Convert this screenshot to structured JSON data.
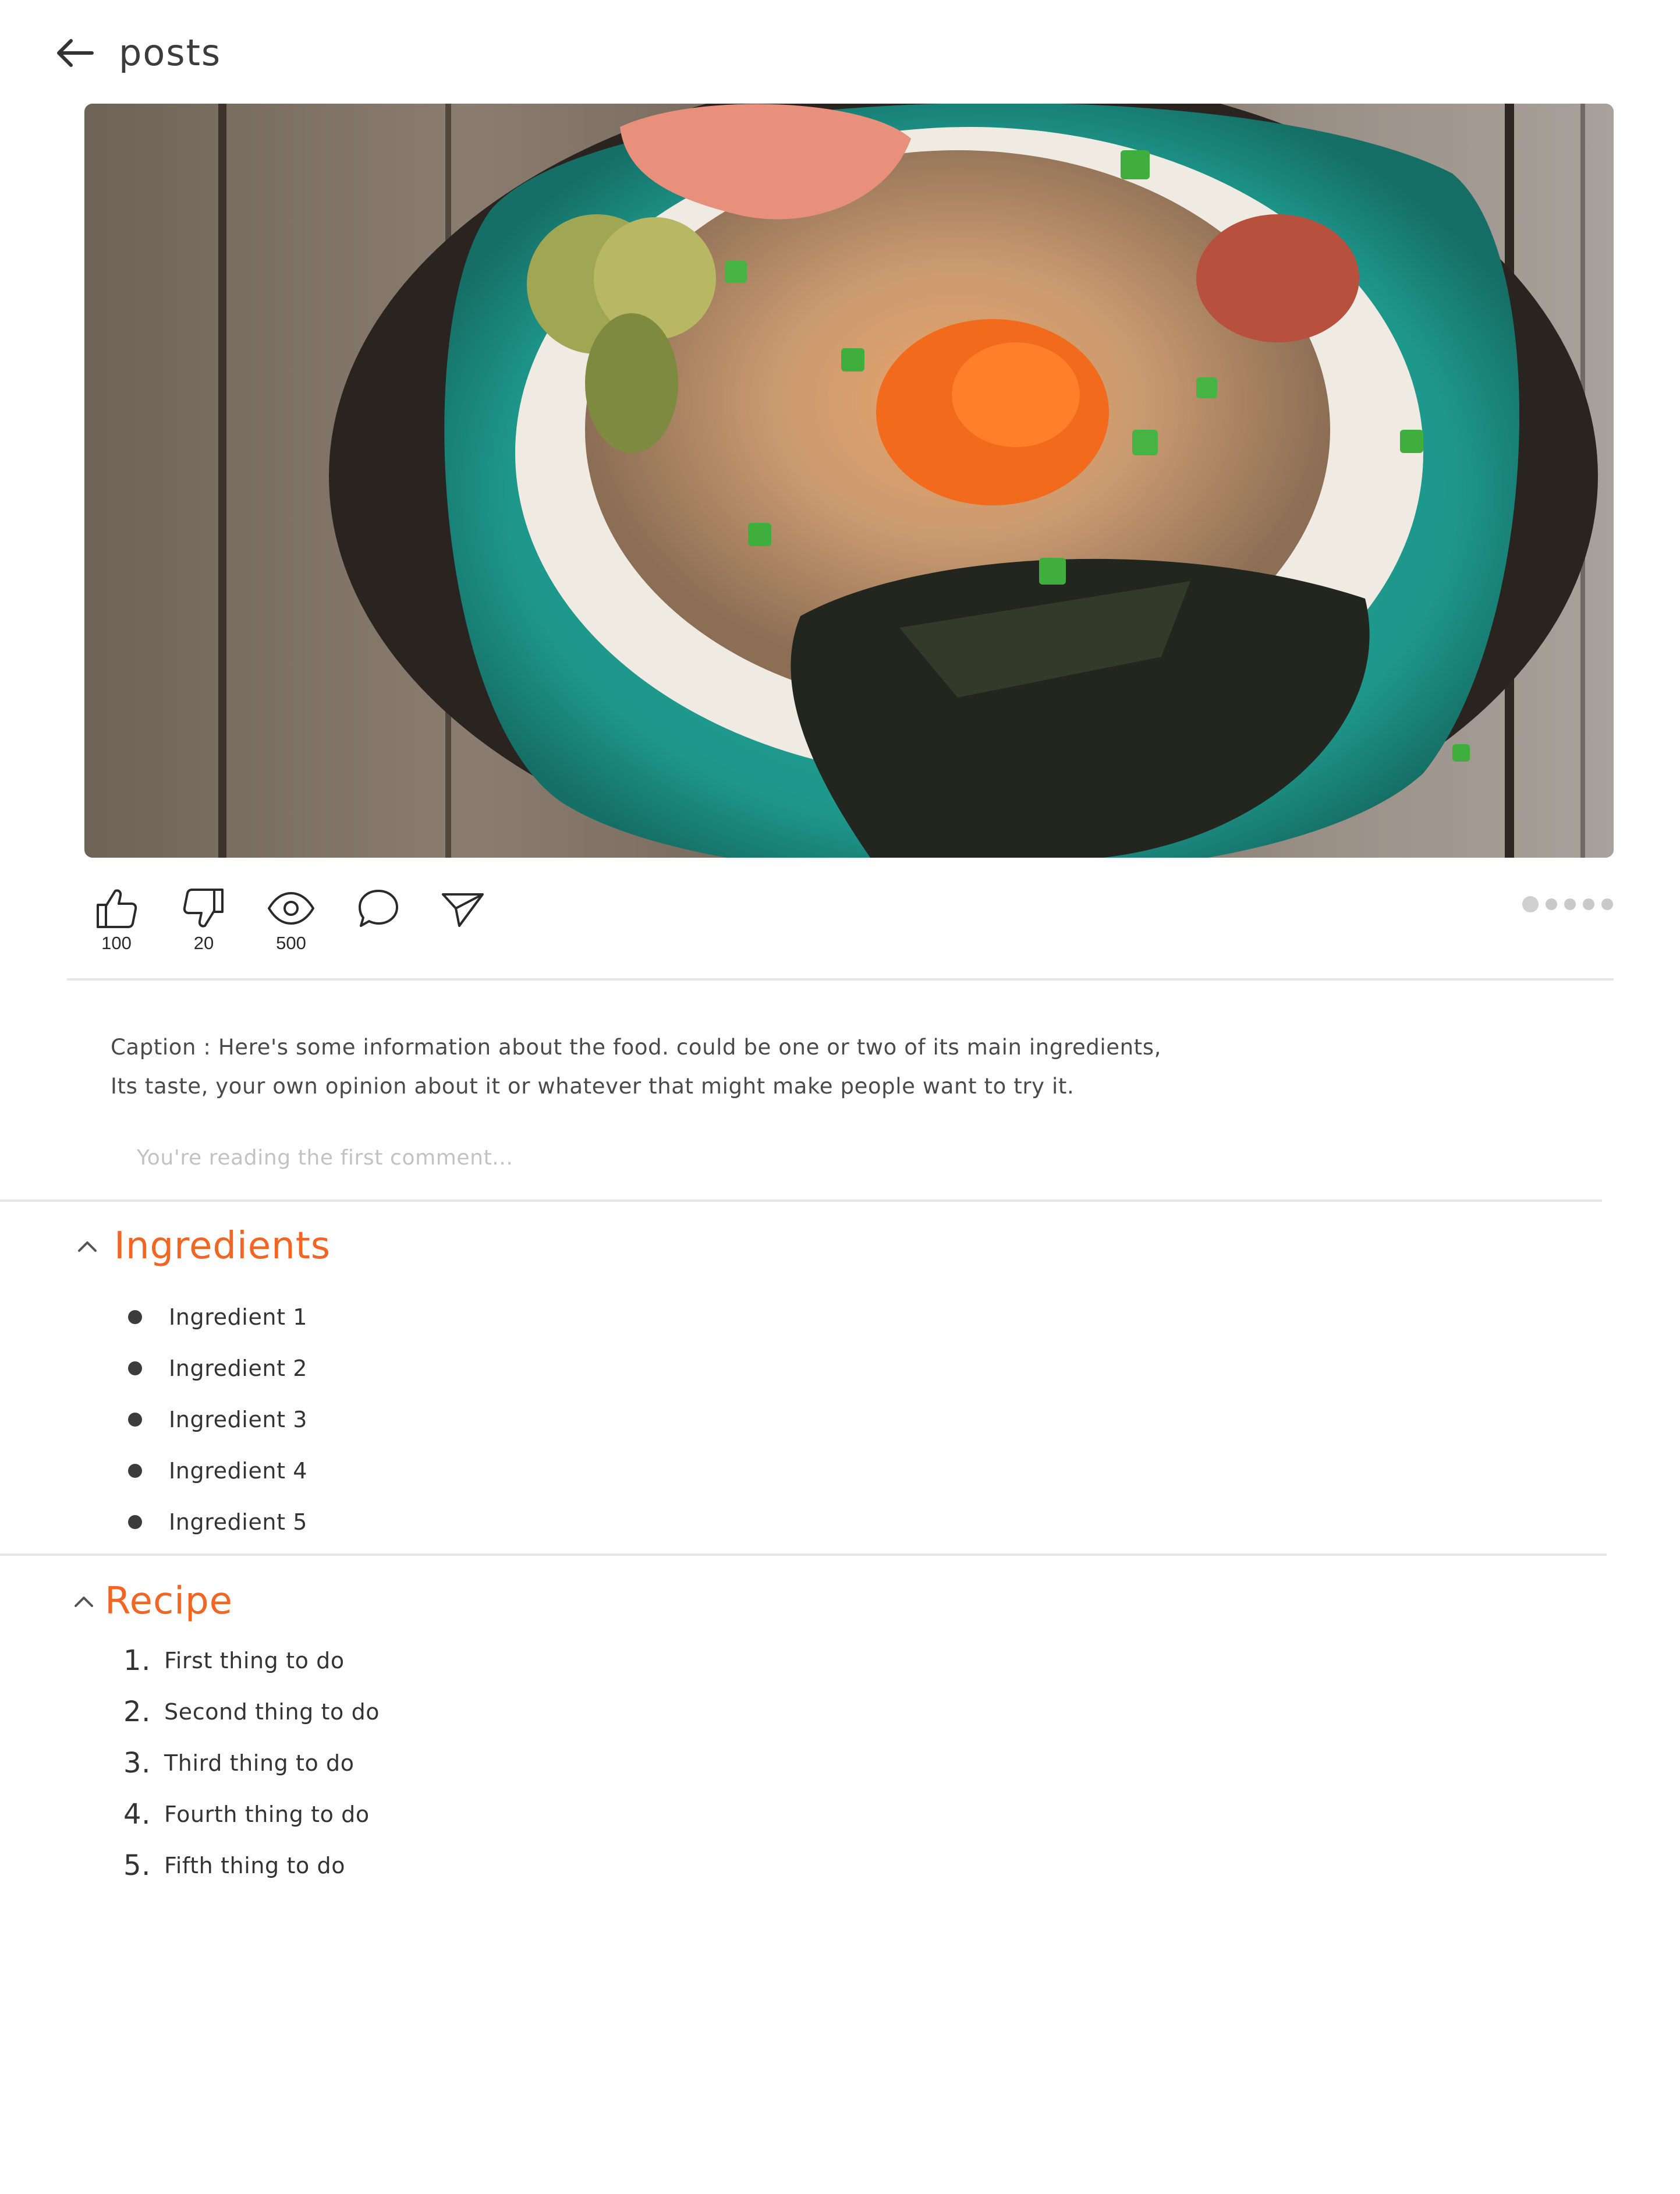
{
  "header": {
    "back_icon": "arrow-left-icon",
    "title": "posts"
  },
  "photo": {
    "subject": "food-bowl-photo"
  },
  "actions": {
    "like": {
      "icon": "thumbs-up-icon",
      "count": "100"
    },
    "dislike": {
      "icon": "thumbs-down-icon",
      "count": "20"
    },
    "views": {
      "icon": "eye-icon",
      "count": "500"
    },
    "comment": {
      "icon": "comment-bubble-icon"
    },
    "share": {
      "icon": "send-icon"
    }
  },
  "pager": {
    "total": 5,
    "active": 1
  },
  "caption": {
    "text": "Caption : Here's some information about the food. could be one or two of its main ingredients,\nIts taste, your own opinion about it or whatever that might make people want to try it."
  },
  "comment_hint": "You're reading the first comment...",
  "ingredients": {
    "title": "Ingredients",
    "items": [
      {
        "label": "Ingredient 1"
      },
      {
        "label": "Ingredient 2"
      },
      {
        "label": "Ingredient 3"
      },
      {
        "label": "Ingredient 4"
      },
      {
        "label": "Ingredient 5"
      }
    ]
  },
  "recipe": {
    "title": "Recipe",
    "steps": [
      {
        "num": "1.",
        "label": "First thing to do"
      },
      {
        "num": "2.",
        "label": "Second thing to do"
      },
      {
        "num": "3.",
        "label": "Third thing to do"
      },
      {
        "num": "4.",
        "label": "Fourth thing to do"
      },
      {
        "num": "5.",
        "label": "Fifth thing to do"
      }
    ]
  },
  "colors": {
    "accent": "#f26522",
    "text": "#3a3a3a",
    "muted": "#c2c2c2",
    "divider": "#e6e6e6"
  }
}
